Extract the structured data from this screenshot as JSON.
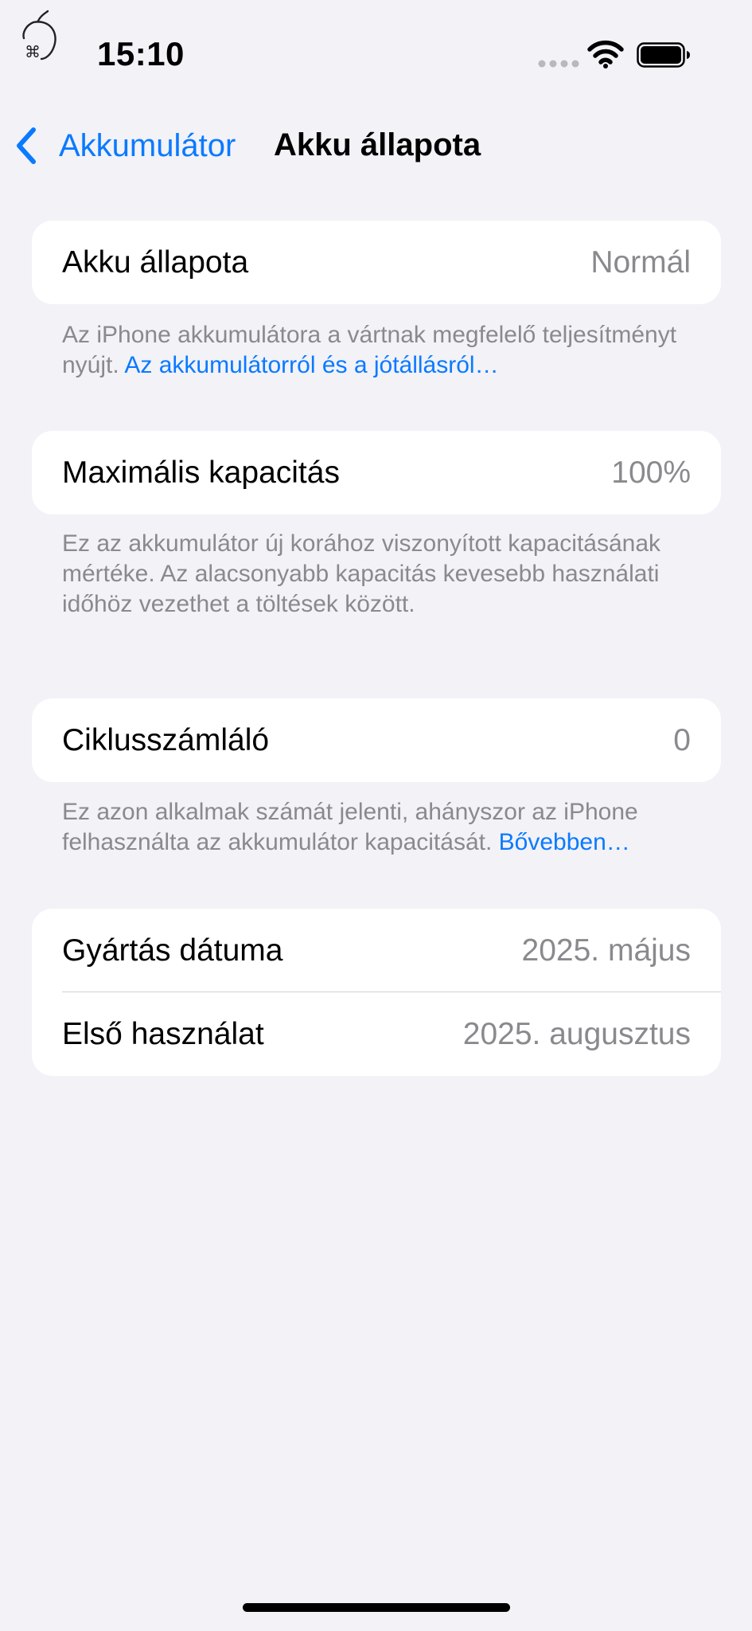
{
  "status_bar": {
    "time": "15:10",
    "app_logo_icon": "apple-command-logo-icon",
    "signal_icon": "cellular-dots-icon",
    "wifi_icon": "wifi-icon",
    "battery_icon": "battery-full-icon"
  },
  "nav": {
    "back_label": "Akkumulátor",
    "title": "Akku állapota",
    "back_icon": "chevron-left-icon",
    "accent_color": "#0a7aff"
  },
  "sections": [
    {
      "rows": [
        {
          "label": "Akku állapota",
          "value": "Normál"
        }
      ],
      "footer_text": "Az iPhone akkumulátora a vártnak megfelelő teljesítményt nyújt. ",
      "footer_link": "Az akkumulátorról és a jótállásról…"
    },
    {
      "rows": [
        {
          "label": "Maximális kapacitás",
          "value": "100%"
        }
      ],
      "footer_text": "Ez az akkumulátor új korához viszonyított kapacitásának mértéke. Az alacsonyabb kapacitás kevesebb használati időhöz vezethet a töltések között.",
      "footer_link": ""
    },
    {
      "rows": [
        {
          "label": "Ciklusszámláló",
          "value": "0"
        }
      ],
      "footer_text": "Ez azon alkalmak számát jelenti, ahányszor az iPhone felhasználta az akkumulátor kapacitását. ",
      "footer_link": "Bővebben…"
    },
    {
      "rows": [
        {
          "label": "Gyártás dátuma",
          "value": "2025. május"
        },
        {
          "label": "Első használat",
          "value": "2025. augusztus"
        }
      ]
    }
  ]
}
